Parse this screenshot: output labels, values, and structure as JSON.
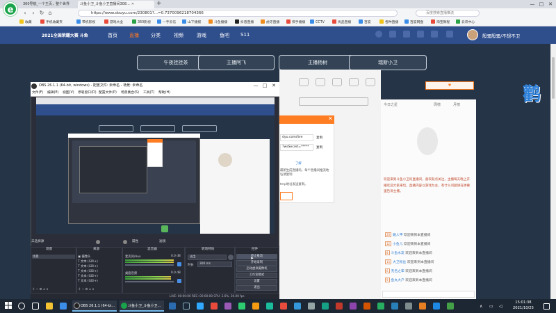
{
  "browser": {
    "tabs": [
      {
        "label": "360导航_一个主页，整个世界",
        "active": false
      },
      {
        "label": "斗鱼小卫_斗鱼小卫直播间308...",
        "active": true
      }
    ],
    "new_tab_glyph": "+",
    "url": "https://www.douyu.com/230801?...=0.7370096218704366",
    "search_placeholder": "百度搜索直播推流",
    "bookmarks": [
      "收藏",
      "手机收藏夹",
      "带机影视",
      "游戏大全",
      "360影视",
      "一手云信",
      "山下播报",
      "斗鱼播播",
      "抖音直播",
      "虎牙直播",
      "快手播播",
      "CCTV",
      "优品直播",
      "百度",
      "各种直播",
      "百度网盘",
      "淘宝教程",
      "云讯中心"
    ],
    "window_buttons": [
      "—",
      "□",
      "✕"
    ]
  },
  "site": {
    "logo_text": "2021全国荣耀大赛 斗鱼",
    "nav": [
      {
        "label": "首页",
        "active": false
      },
      {
        "label": "直播",
        "active": true
      },
      {
        "label": "分类",
        "active": false
      },
      {
        "label": "视频",
        "active": false
      },
      {
        "label": "游戏",
        "active": false
      },
      {
        "label": "鱼吧",
        "active": false
      },
      {
        "label": "S11",
        "active": false
      }
    ],
    "user_name": "殷骚殷骚/不想不卫",
    "category_buttons": [
      "午夜挂挂茶",
      "主播阿飞",
      "主播杨树",
      "瑞斯小卫"
    ],
    "danmu_logo": "鹳",
    "right_panel": {
      "tabs": [
        "今日之星",
        "周榜",
        "月榜"
      ],
      "announcement": "欢迎来到斗鱼小卫的直播间，喜欢就点关注，主播每天晚上开播欢迎大家来玩，直播内容以游戏为主，有什么问题请在弹幕里告诉主播。",
      "chat": [
        {
          "user": "路人甲",
          "text": "欢迎来到本直播间"
        },
        {
          "user": "小鱼儿",
          "text": "欢迎来到本直播间"
        },
        {
          "user": "斗鱼水友",
          "text": "欢迎来到本直播间"
        },
        {
          "user": "大卫粉丝",
          "text": "欢迎来到本直播间"
        },
        {
          "user": "无名之辈",
          "text": "欢迎来到本直播间"
        },
        {
          "user": "鱼丸大户",
          "text": "欢迎来到本直播间"
        }
      ]
    },
    "popup": {
      "field1": "dyu.com/live",
      "field2": "?wsSecret=*****",
      "copy1": "复制",
      "copy2": "复制",
      "hint": "了解",
      "note": "最新生成直播码，每个直播间推流地址请复制",
      "note2": "tmp地址发送复制。"
    }
  },
  "obs": {
    "title": "OBS 26.1.1 (64-bit, windows) - 配置文件: 未命名 - 场景: 未命名",
    "menu": [
      "文件(F)",
      "编辑(E)",
      "视图(V)",
      "停靠窗口(D)",
      "配置文件(P)",
      "场景集合(S)",
      "工具(T)",
      "帮助(H)"
    ],
    "no_source": "未选择源",
    "props_btn": "属性",
    "filters_btn": "滤镜",
    "docks": {
      "scenes": {
        "title": "场景",
        "items": [
          "场景"
        ]
      },
      "sources": {
        "title": "来源",
        "items": [
          "摄像头",
          "文本 (GDI+)",
          "文本 (GDI+)",
          "文本 (GDI+)",
          "文本 (GDI+)",
          "文本 (GDI+)"
        ]
      },
      "mixer": {
        "title": "混音器",
        "channels": [
          {
            "name": "麦克风/Aux",
            "level": "0.0 dB"
          },
          {
            "name": "桌面音频",
            "level": "0.0 dB"
          }
        ]
      },
      "transitions": {
        "title": "转场特效",
        "type": "淡出",
        "duration_label": "时长",
        "duration": "300 ms"
      },
      "controls": {
        "title": "控件",
        "buttons": [
          "停止推流",
          "开始录制",
          "启动虚拟摄像机",
          "工作室模式",
          "设置",
          "退出"
        ]
      }
    },
    "status": "LIVE: 00:00:00   REC: 00:00:00   CPU: 2.6%, 30.00 fps"
  },
  "taskbar": {
    "apps": [
      {
        "label": "OBS 26.1.1 (64-bi..."
      },
      {
        "label": "斗鱼小卫_斗鱼小卫..."
      }
    ],
    "time": "15:01:38",
    "date": "2021/10/25"
  },
  "colors": {
    "douyu_nav": "#2f4e8c",
    "douyu_accent": "#ff7d22",
    "obs_bg": "#2b2e38",
    "taskbar": "#1d2733"
  }
}
